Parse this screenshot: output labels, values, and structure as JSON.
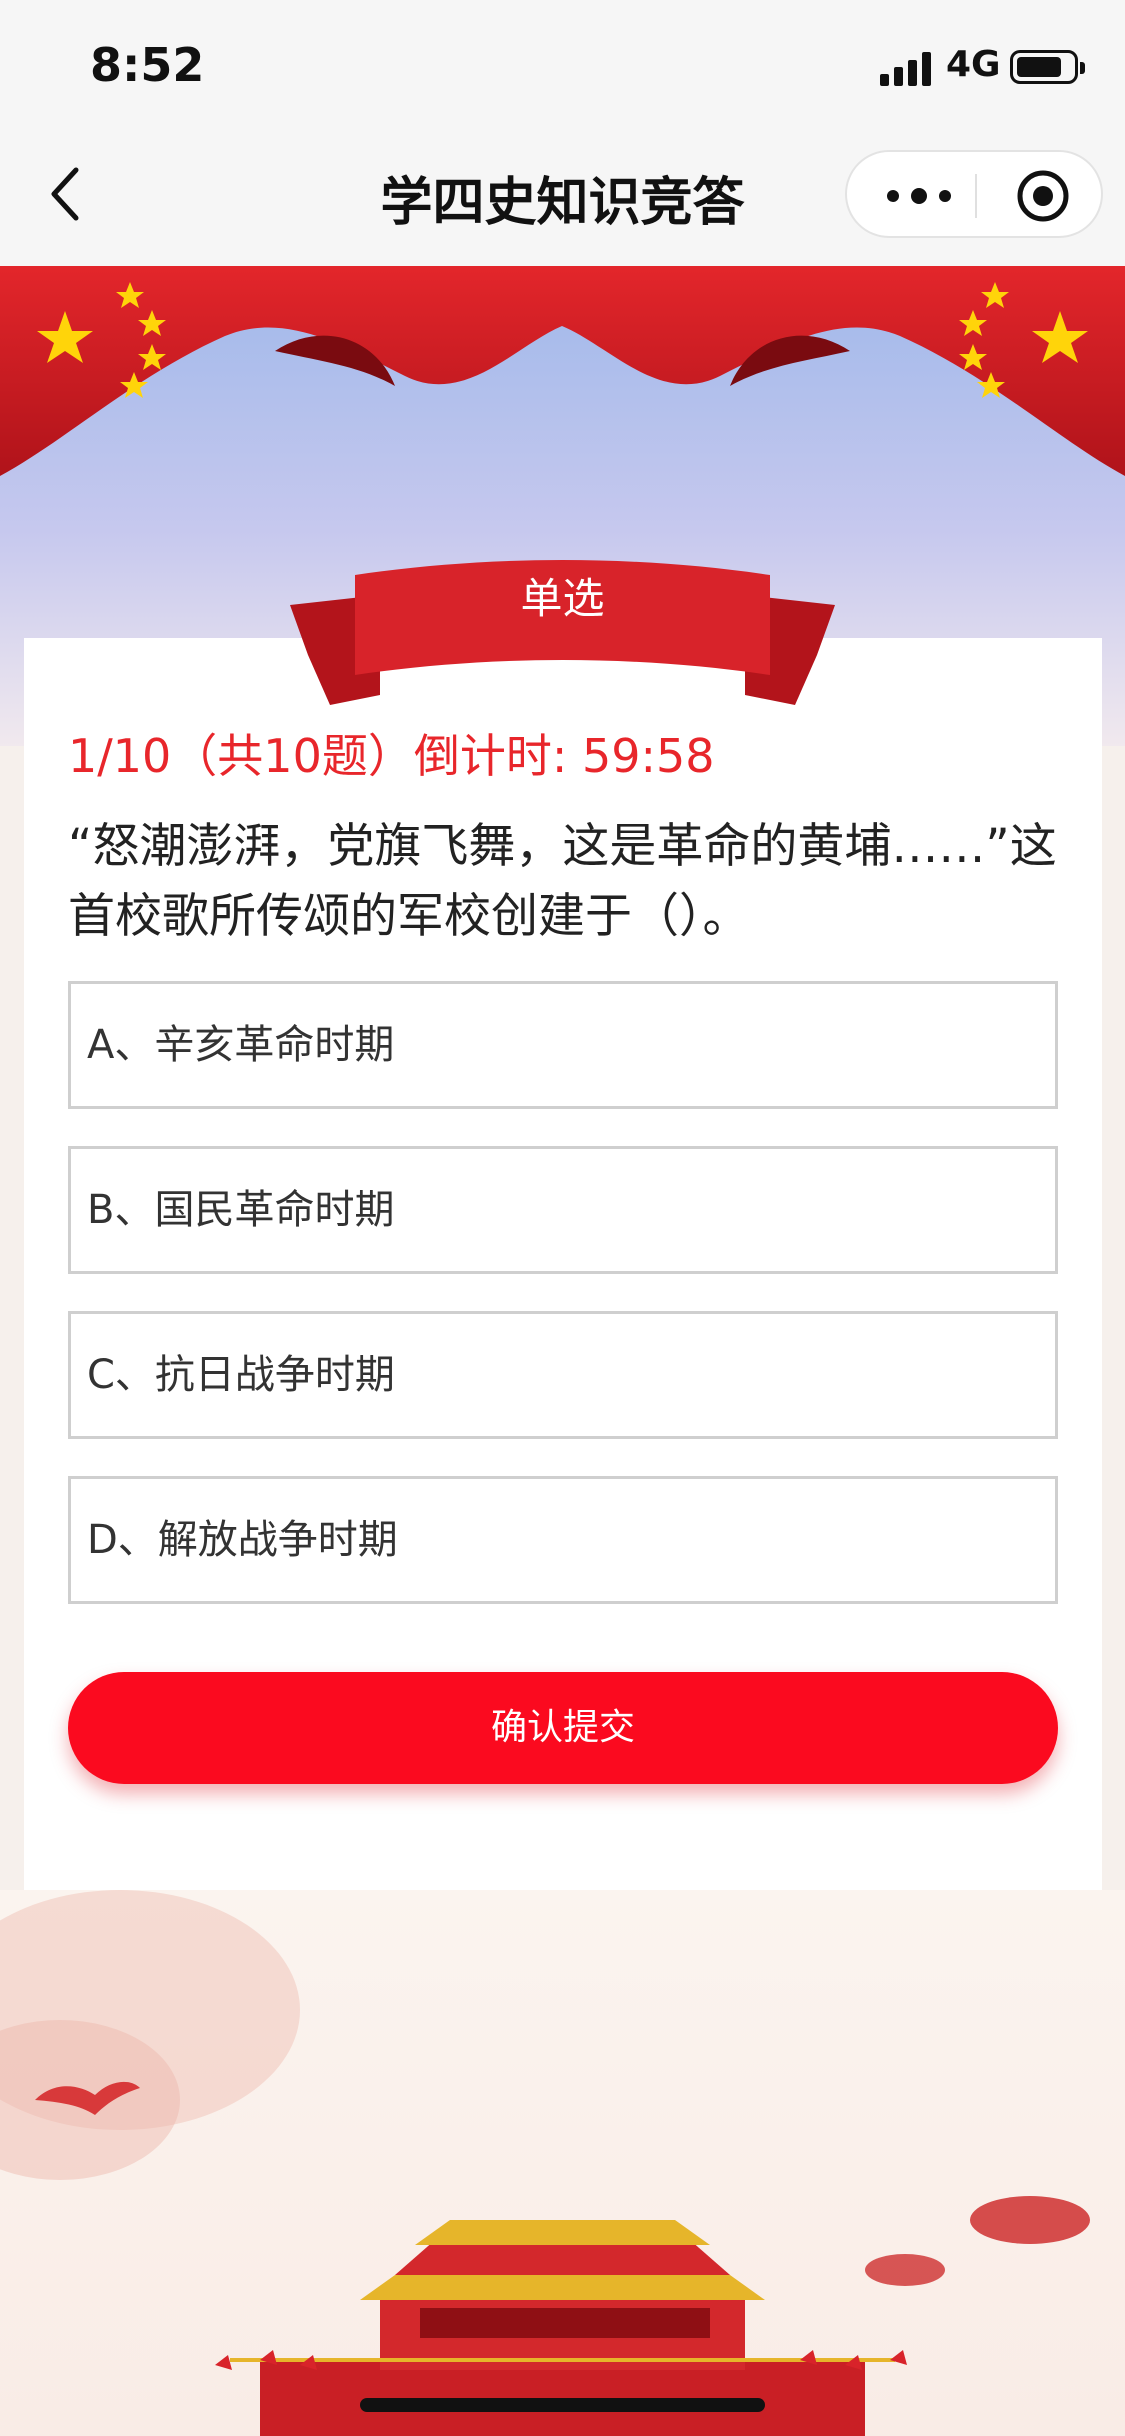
{
  "status_bar": {
    "time": "8:52",
    "network": "4G",
    "battery_level": 0.7
  },
  "nav": {
    "title": "学四史知识竞答",
    "more_icon": "more-dots-icon",
    "close_icon": "target-circle-icon"
  },
  "quiz": {
    "type_label": "单选",
    "progress": "1/10（共10题）倒计时: 59:58",
    "question": "“怒潮澎湃，党旗飞舞，这是革命的黄埔……”这首校歌所传颂的军校创建于（）。",
    "options": [
      "A、辛亥革命时期",
      "B、国民革命时期",
      "C、抗日战争时期",
      "D、解放战争时期"
    ],
    "submit_label": "确认提交"
  },
  "colors": {
    "accent": "#fb0a1f",
    "progress_text": "#e8262b",
    "flag_red": "#d81e23",
    "star_yellow": "#ffd40a"
  }
}
